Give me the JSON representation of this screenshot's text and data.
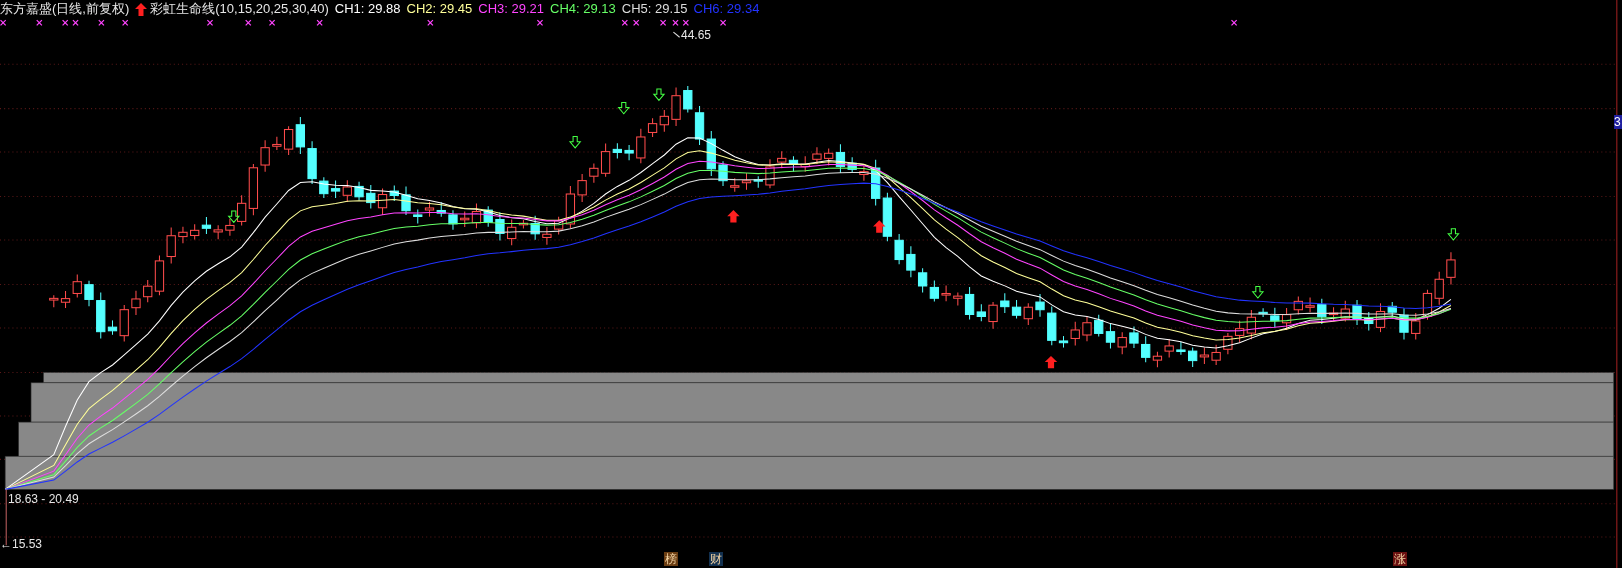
{
  "header": {
    "title": "东方嘉盛(日线,前复权)",
    "indicator": "彩虹生命线(10,15,20,25,30,40)",
    "lines": [
      {
        "label": "CH1: 29.88",
        "color": "#ffffff"
      },
      {
        "label": "CH2: 29.45",
        "color": "#ffff99"
      },
      {
        "label": "CH3: 29.21",
        "color": "#ff44ff"
      },
      {
        "label": "CH4: 29.13",
        "color": "#66ff66"
      },
      {
        "label": "CH5: 29.15",
        "color": "#dddddd"
      },
      {
        "label": "CH6: 29.34",
        "color": "#2233ff"
      }
    ]
  },
  "chart": {
    "high_label": "44.65",
    "range_label": "18.63 - 20.49",
    "low_label": "←15.53",
    "axis_badge": "3"
  },
  "event_markers": [
    {
      "label": "榜",
      "color": "#6b3d12"
    },
    {
      "label": "财",
      "color": "#12304f"
    },
    {
      "label": "涨",
      "color": "#6b1010"
    }
  ]
}
